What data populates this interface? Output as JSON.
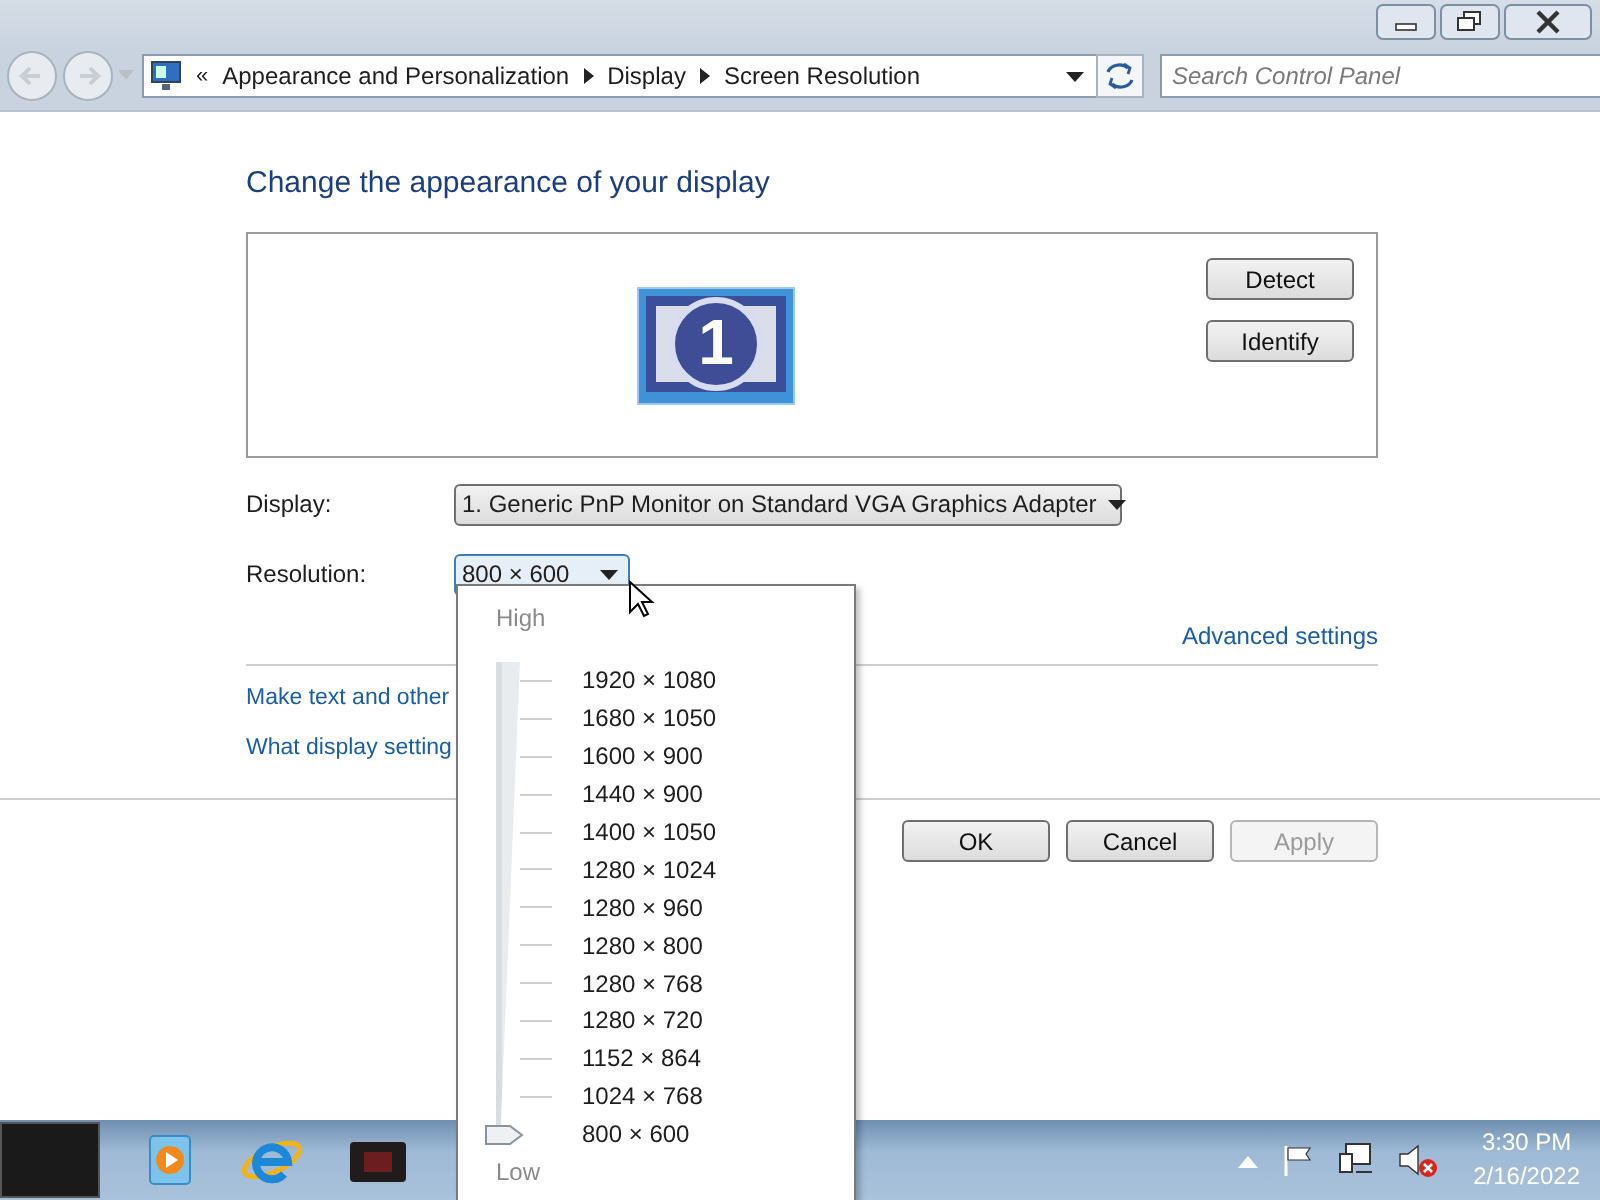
{
  "address_bar": {
    "overflow": "«",
    "crumbs": [
      "Appearance and Personalization",
      "Display",
      "Screen Resolution"
    ]
  },
  "search": {
    "placeholder": "Search Control Panel"
  },
  "heading": "Change the appearance of your display",
  "monitor_panel": {
    "monitor_number": "1",
    "buttons": [
      "Detect",
      "Identify"
    ]
  },
  "display": {
    "label": "Display:",
    "value": "1. Generic PnP Monitor on Standard VGA Graphics Adapter"
  },
  "resolution": {
    "label": "Resolution:",
    "value": "800 × 600"
  },
  "resolution_menu": {
    "high_label": "High",
    "low_label": "Low",
    "options": [
      {
        "label": "1920 × 1080",
        "selected": false
      },
      {
        "label": "1680 × 1050",
        "selected": false
      },
      {
        "label": "1600 × 900",
        "selected": false
      },
      {
        "label": "1440 × 900",
        "selected": false
      },
      {
        "label": "1400 × 1050",
        "selected": false
      },
      {
        "label": "1280 × 1024",
        "selected": false
      },
      {
        "label": "1280 × 960",
        "selected": false
      },
      {
        "label": "1280 × 800",
        "selected": false
      },
      {
        "label": "1280 × 768",
        "selected": false
      },
      {
        "label": "1280 × 720",
        "selected": false
      },
      {
        "label": "1152 × 864",
        "selected": false
      },
      {
        "label": "1024 × 768",
        "selected": false
      },
      {
        "label": "800 × 600",
        "selected": true
      }
    ]
  },
  "advanced_link": "Advanced settings",
  "links": [
    "Make text and other",
    "What display setting"
  ],
  "buttons": [
    {
      "label": "OK",
      "disabled": false
    },
    {
      "label": "Cancel",
      "disabled": false
    },
    {
      "label": "Apply",
      "disabled": true
    }
  ],
  "taskbar": {
    "clock": {
      "time": "3:30 PM",
      "date": "2/16/2022"
    }
  }
}
